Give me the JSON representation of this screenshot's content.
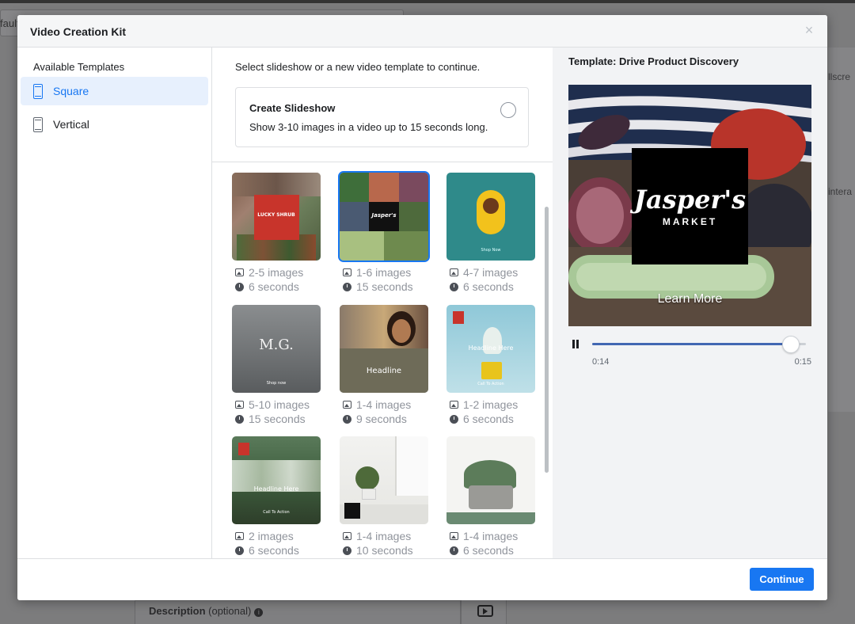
{
  "background": {
    "field_text": "fault",
    "right_text_1": "llscre",
    "right_text_2": "intera",
    "description_label": "Description",
    "description_optional": "(optional)"
  },
  "modal": {
    "title": "Video Creation Kit",
    "close_glyph": "×"
  },
  "sidebar": {
    "heading": "Available Templates",
    "items": [
      {
        "label": "Square",
        "selected": true
      },
      {
        "label": "Vertical",
        "selected": false
      }
    ]
  },
  "center": {
    "intro": "Select slideshow or a new video template to continue.",
    "slideshow": {
      "title": "Create Slideshow",
      "description": "Show 3-10 images in a video up to 15 seconds long."
    },
    "templates": [
      {
        "images": "2-5 images",
        "duration": "6 seconds",
        "thumb_text": "LUCKY SHRUB",
        "selected": false
      },
      {
        "images": "1-6 images",
        "duration": "15 seconds",
        "thumb_text": "Jasper's",
        "selected": true
      },
      {
        "images": "4-7 images",
        "duration": "6 seconds",
        "thumb_text": "Shop Now",
        "selected": false
      },
      {
        "images": "5-10 images",
        "duration": "15 seconds",
        "thumb_text": "M.G.",
        "thumb_sub": "Shop now",
        "selected": false
      },
      {
        "images": "1-4 images",
        "duration": "9 seconds",
        "thumb_text": "Headline",
        "selected": false
      },
      {
        "images": "1-2 images",
        "duration": "6 seconds",
        "thumb_text": "Headline Here",
        "thumb_sub": "Call To Action",
        "selected": false
      },
      {
        "images": "2 images",
        "duration": "6 seconds",
        "thumb_text": "Headline Here",
        "thumb_sub": "Call To Action",
        "selected": false
      },
      {
        "images": "1-4 images",
        "duration": "10 seconds",
        "thumb_text": "",
        "selected": false
      },
      {
        "images": "1-4 images",
        "duration": "6 seconds",
        "thumb_text": "",
        "selected": false
      }
    ]
  },
  "preview": {
    "title": "Template: Drive Product Discovery",
    "logo_main": "Jasper's",
    "logo_sub": "MARKET",
    "cta": "Learn More",
    "time_start": "0:14",
    "time_end": "0:15",
    "progress": 0.93
  },
  "footer": {
    "continue_label": "Continue"
  },
  "colors": {
    "accent": "#1877f2",
    "selected_bg": "#e7f0fd",
    "preview_bg": "#f2f3f5"
  }
}
